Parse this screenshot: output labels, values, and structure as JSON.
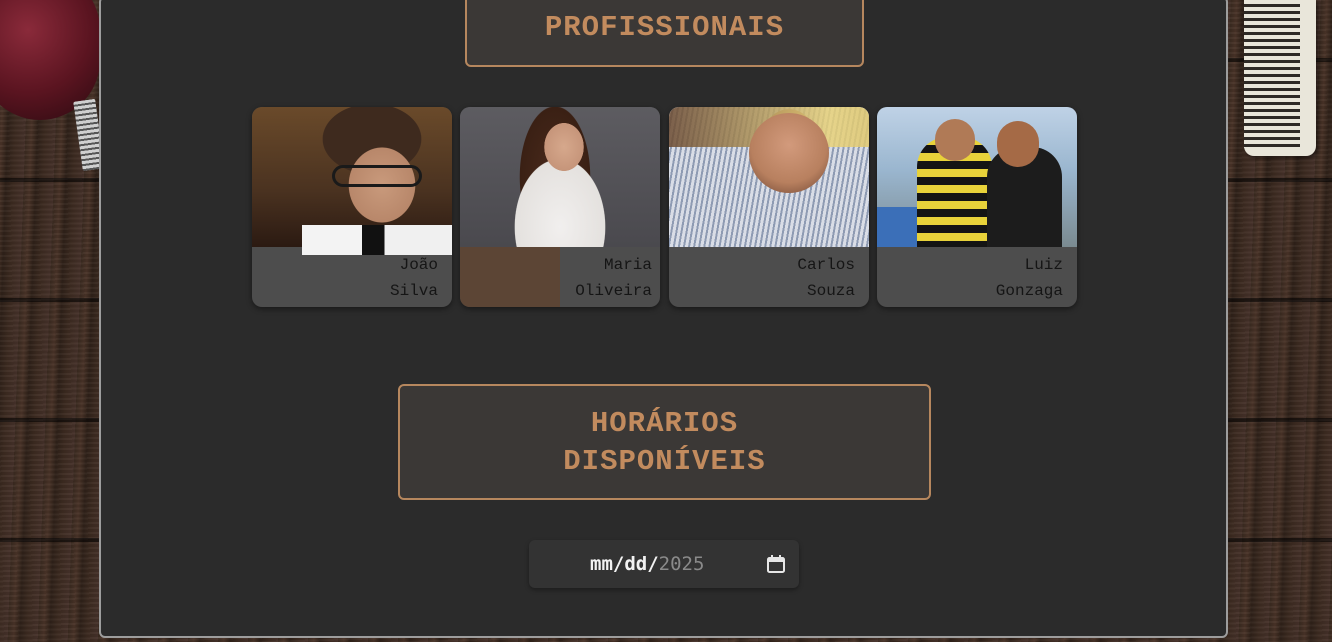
{
  "sections": {
    "professionals_title": "PROFISSIONAIS",
    "schedule_title_line1": "HORÁRIOS",
    "schedule_title_line2": "DISPONÍVEIS"
  },
  "professionals": [
    {
      "first": "João",
      "last": "Silva",
      "photo": "portrait-joao-silva"
    },
    {
      "first": "Maria",
      "last": "Oliveira",
      "photo": "portrait-maria-oliveira"
    },
    {
      "first": "Carlos",
      "last": "Souza",
      "photo": "portrait-carlos-souza"
    },
    {
      "first": "Luiz",
      "last": "Gonzaga",
      "photo": "portrait-luiz-gonzaga"
    }
  ],
  "date_picker": {
    "mask": "mm/dd/",
    "year": "2025",
    "icon": "calendar-icon"
  },
  "decor": {
    "background": "wood-texture",
    "top_left_item": "hair-clipper",
    "top_right_item": "comb"
  },
  "colors": {
    "accent": "#c28b5e",
    "border_accent": "#b6875e",
    "panel": "#2b2b2b",
    "card": "#4d4d4d",
    "title_box": "#3b3836"
  }
}
